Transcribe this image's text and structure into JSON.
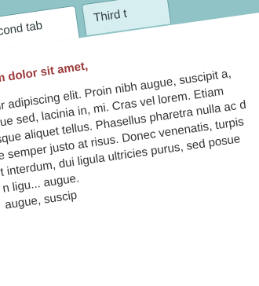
{
  "tabs": {
    "items": [
      {
        "label": "econd tab"
      },
      {
        "label": "Third t"
      }
    ]
  },
  "content": {
    "heading": "um dolor sit amet,",
    "lines": [
      "tur adipiscing elit. Proin nibh augue, suscipit a,",
      "que sed, lacinia in, mi. Cras vel lorem. Etiam",
      "sque aliquet tellus. Phasellus pharetra nulla ac d",
      "e semper justo at risus. Donec venenatis, turpis",
      "t interdum, dui ligula ultricies purus, sed posue",
      "n ligu... augue.",
      "                                       augue, suscip"
    ]
  }
}
